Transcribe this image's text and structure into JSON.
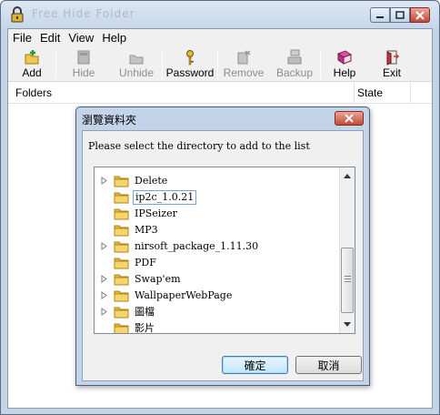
{
  "window": {
    "title": "Free Hide Folder",
    "controls": [
      "minimize",
      "maximize",
      "close"
    ]
  },
  "menu": [
    "File",
    "Edit",
    "View",
    "Help"
  ],
  "toolbar": {
    "add": "Add",
    "hide": "Hide",
    "unhide": "Unhide",
    "password": "Password",
    "remove": "Remove",
    "backup": "Backup",
    "help": "Help",
    "exit": "Exit"
  },
  "list": {
    "col_folders": "Folders",
    "col_state": "State"
  },
  "dialog": {
    "title": "瀏覽資料夾",
    "message": "Please select the directory to add to the list",
    "ok": "確定",
    "cancel": "取消",
    "selected": "ip2c_1.0.21",
    "tree": [
      {
        "label": "Delete",
        "expandable": true
      },
      {
        "label": "ip2c_1.0.21",
        "expandable": false,
        "selected": true
      },
      {
        "label": "IPSeizer",
        "expandable": false
      },
      {
        "label": "MP3",
        "expandable": false
      },
      {
        "label": "nirsoft_package_1.11.30",
        "expandable": true
      },
      {
        "label": "PDF",
        "expandable": false
      },
      {
        "label": "Swap'em",
        "expandable": true
      },
      {
        "label": "WallpaperWebPage",
        "expandable": true
      },
      {
        "label": "圖檔",
        "expandable": true
      },
      {
        "label": "影片",
        "expandable": false
      }
    ]
  },
  "colors": {
    "chrome": "#c5d3e6",
    "close_red": "#c0483a",
    "folder_yellow": "#f0c44c",
    "selection_border": "#7da2ce"
  }
}
